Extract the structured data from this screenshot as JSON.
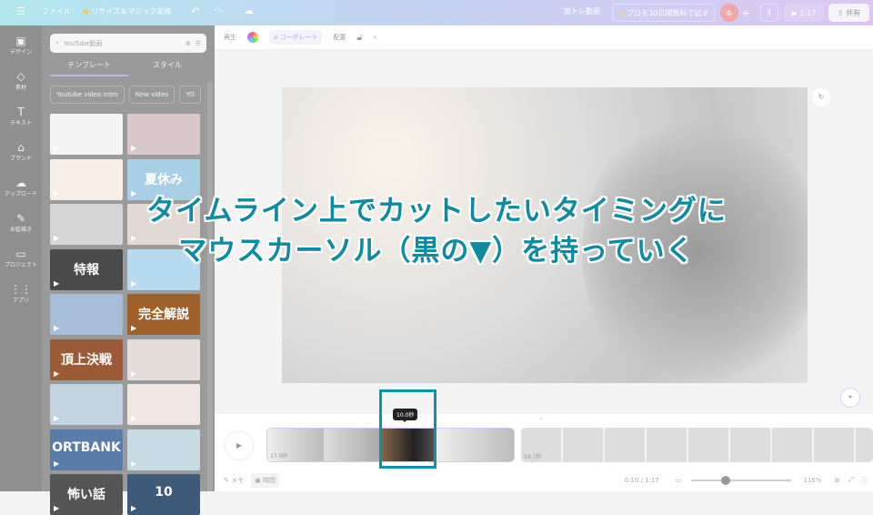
{
  "topbar": {
    "file": "ファイル",
    "resize": "リサイズ＆マジック変換",
    "project_name": "筋トレ動画",
    "pro_trial": "プロを30日間無料で試す",
    "avatar": "キ",
    "play_time": "1:17",
    "share": "共有"
  },
  "rail": [
    {
      "label": "デザイン",
      "icon": "▣"
    },
    {
      "label": "素材",
      "icon": "◇"
    },
    {
      "label": "テキスト",
      "icon": "T"
    },
    {
      "label": "ブランド",
      "icon": "⌂"
    },
    {
      "label": "アップロード",
      "icon": "☁"
    },
    {
      "label": "お絵描き",
      "icon": "✎"
    },
    {
      "label": "プロジェクト",
      "icon": "▭"
    },
    {
      "label": "アプリ",
      "icon": "⋮⋮"
    }
  ],
  "panel": {
    "search_placeholder": "YouTube動画",
    "tabs": [
      "テンプレート",
      "スタイル"
    ],
    "chips": [
      "Youtube video intro",
      "New video",
      "YO"
    ],
    "thumbs": [
      {
        "text": "",
        "bg": "#f4f4f4"
      },
      {
        "text": "",
        "bg": "#d9c7cb"
      },
      {
        "text": "",
        "bg": "#f7ede7"
      },
      {
        "text": "夏休み",
        "bg": "#a9cfe6"
      },
      {
        "text": "",
        "bg": "#d5d5d5"
      },
      {
        "text": "",
        "bg": "#e2d8d4"
      },
      {
        "text": "特報",
        "bg": "#4a4a4a"
      },
      {
        "text": "",
        "bg": "#b8dcef"
      },
      {
        "text": "",
        "bg": "#a7bed8"
      },
      {
        "text": "完全解説",
        "bg": "#a0602a"
      },
      {
        "text": "頂上決戦",
        "bg": "#9c5a36"
      },
      {
        "text": "",
        "bg": "#e4dcd8"
      },
      {
        "text": "",
        "bg": "#c3d3e2"
      },
      {
        "text": "",
        "bg": "#efe6e2"
      },
      {
        "text": "ORTBANK",
        "bg": "#5a7ca8"
      },
      {
        "text": "",
        "bg": "#c7dbe3"
      },
      {
        "text": "怖い話",
        "bg": "#555"
      },
      {
        "text": "10",
        "bg": "#3d5a78"
      }
    ]
  },
  "toolbar": {
    "play": "再生",
    "corporate": "コーポレート",
    "arrange": "配置"
  },
  "caption": {
    "line1": "タイムライン上でカットしたいタイミングに",
    "line2": "マウスカーソル（黒の▼）を持っていく"
  },
  "timeline": {
    "tooltip": "10.0秒",
    "clip1_duration": "17.9秒",
    "clip2_duration": "59.7秒"
  },
  "bottom": {
    "notes": "メモ",
    "timer": "時間",
    "time": "0:10 / 1:17",
    "zoom": "116%",
    "zoom_fraction": 0.3
  },
  "colors": {
    "accent": "#0b93a8",
    "purple": "#8b3dff"
  }
}
